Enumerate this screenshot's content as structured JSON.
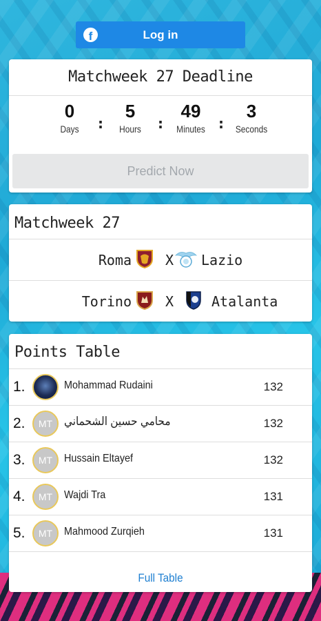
{
  "login": {
    "label": "Log in",
    "icon": "facebook-icon"
  },
  "deadline": {
    "title": "Matchweek 27 Deadline",
    "countdown": [
      {
        "value": "0",
        "label": "Days"
      },
      {
        "value": "5",
        "label": "Hours"
      },
      {
        "value": "49",
        "label": "Minutes"
      },
      {
        "value": "3",
        "label": "Seconds"
      }
    ],
    "separator": ":",
    "predict_label": "Predict Now"
  },
  "matchweek": {
    "title": "Matchweek 27",
    "vs_label": "X",
    "matches": [
      {
        "home": "Roma",
        "home_crest": "roma-crest",
        "away": "Lazio",
        "away_crest": "lazio-crest"
      },
      {
        "home": "Torino",
        "home_crest": "torino-crest",
        "away": "Atalanta",
        "away_crest": "atalanta-crest"
      }
    ]
  },
  "points_table": {
    "title": "Points Table",
    "rows": [
      {
        "rank": "1.",
        "avatar": "",
        "name": "Mohammad Rudaini",
        "points": "132"
      },
      {
        "rank": "2.",
        "avatar": "MT",
        "name": "محامي حسين الشحماني",
        "points": "132"
      },
      {
        "rank": "3.",
        "avatar": "MT",
        "name": "Hussain Eltayef",
        "points": "132"
      },
      {
        "rank": "4.",
        "avatar": "MT",
        "name": "Wajdi Tra",
        "points": "131"
      },
      {
        "rank": "5.",
        "avatar": "MT",
        "name": "Mahmood Zurqieh",
        "points": "131"
      }
    ],
    "full_table_label": "Full Table"
  },
  "colors": {
    "primary_blue": "#1e88e5",
    "link_blue": "#1e7fd1",
    "avatar_ring": "#e9c85a",
    "disabled_button": "#e6e7e8"
  }
}
